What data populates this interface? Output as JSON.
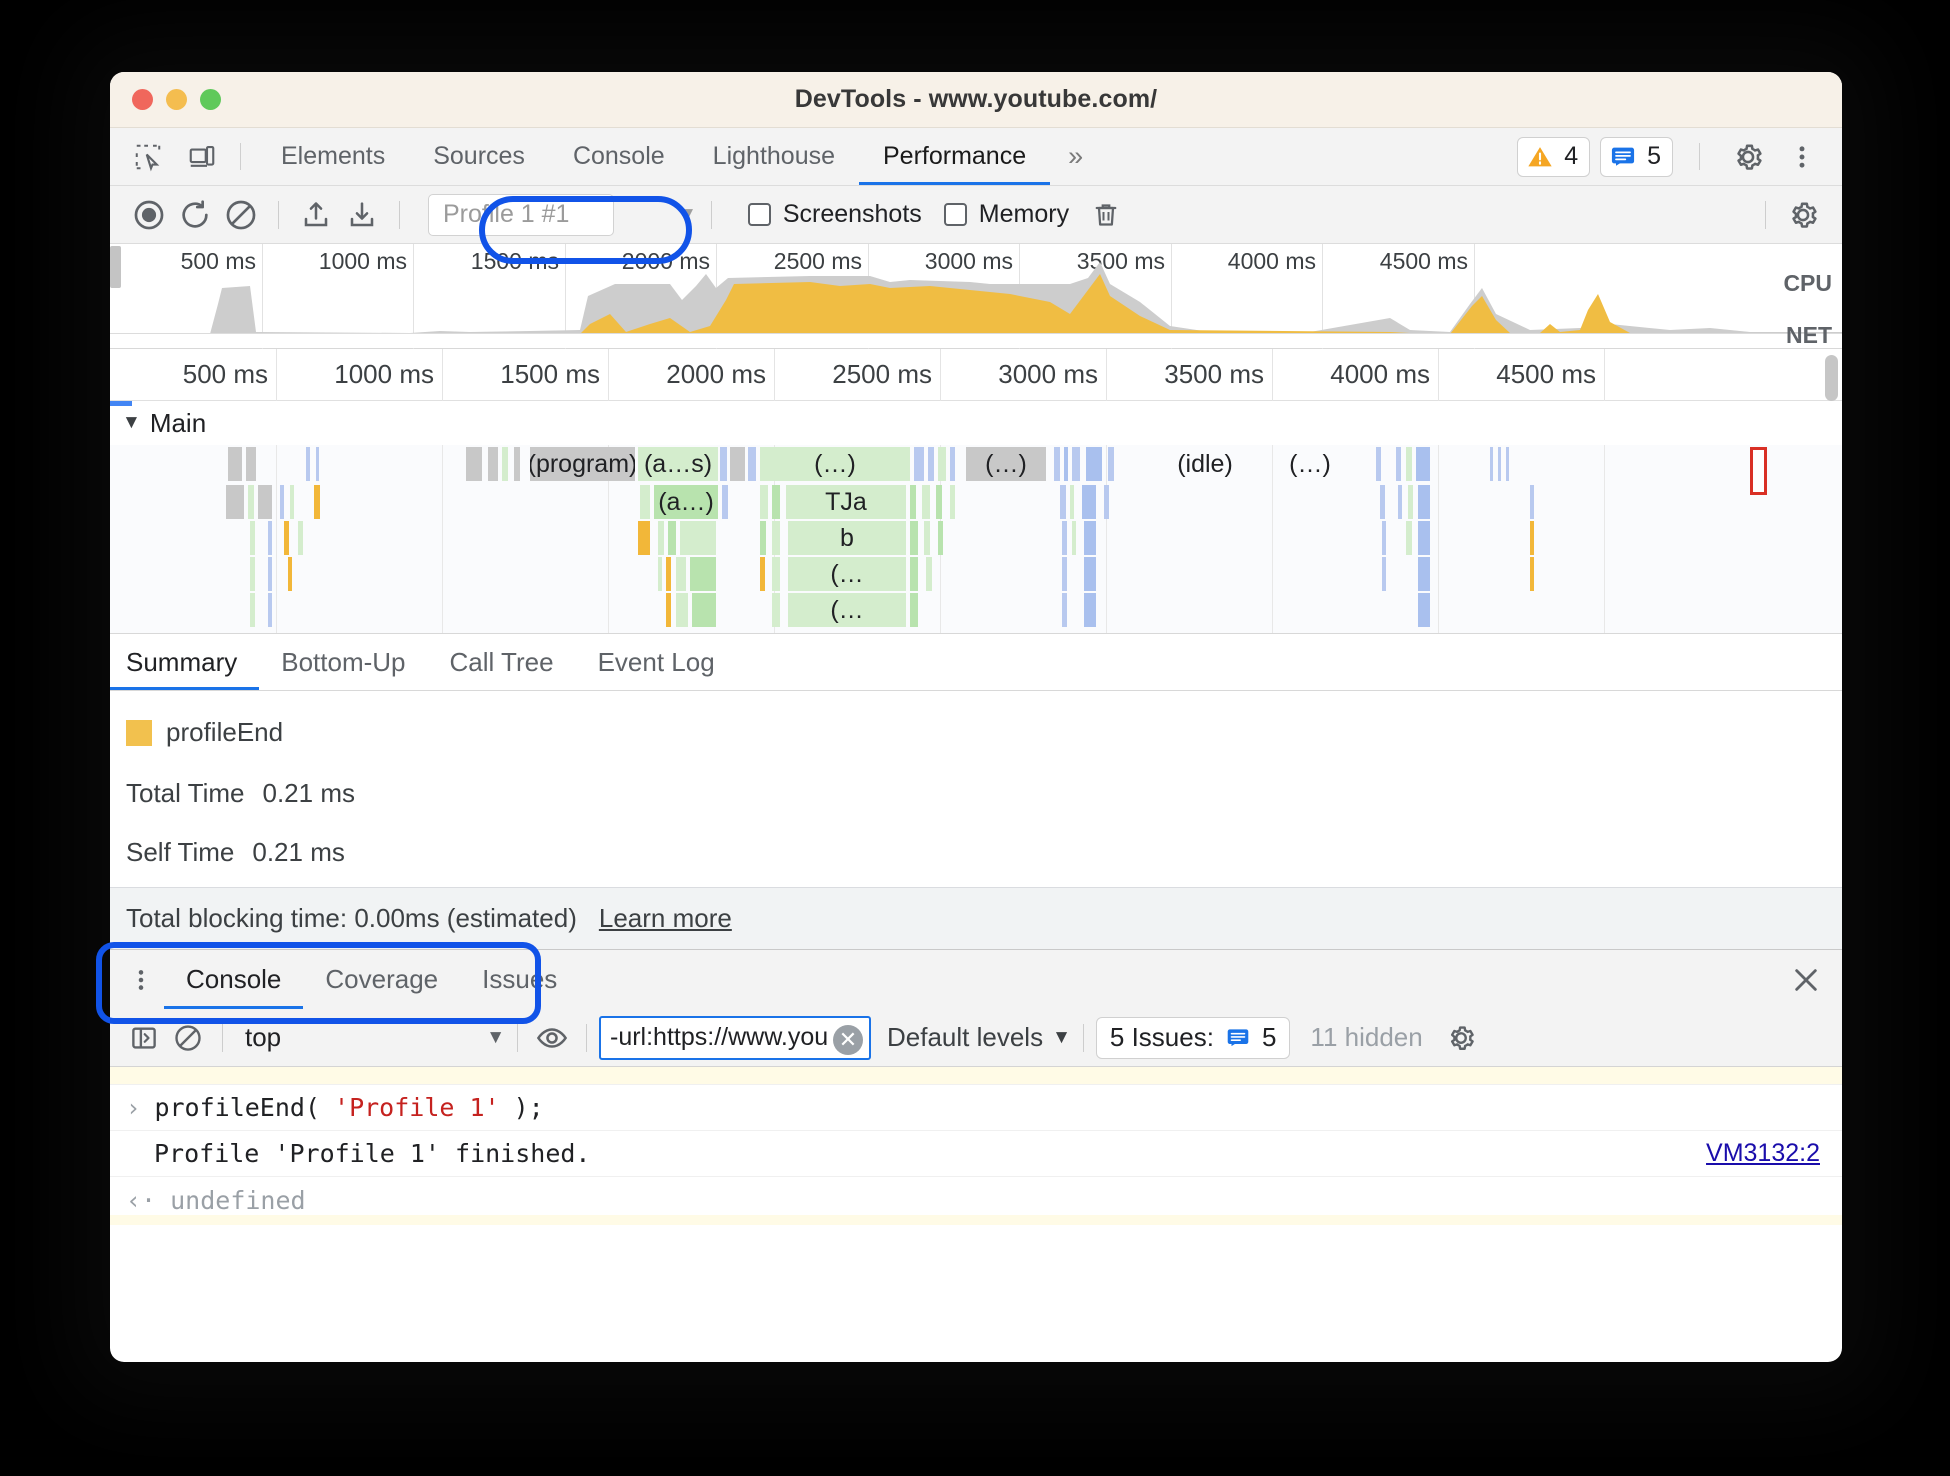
{
  "window": {
    "title": "DevTools - www.youtube.com/"
  },
  "main_tabs": {
    "items": [
      {
        "label": "Elements",
        "active": false
      },
      {
        "label": "Sources",
        "active": false
      },
      {
        "label": "Console",
        "active": false
      },
      {
        "label": "Lighthouse",
        "active": false
      },
      {
        "label": "Performance",
        "active": true
      }
    ],
    "more_label": "»",
    "warnings_count": "4",
    "issues_count": "5"
  },
  "perf_toolbar": {
    "profile_value": "Profile 1 #1",
    "caret": "▼",
    "screenshots_label": "Screenshots",
    "memory_label": "Memory",
    "screenshots_checked": false,
    "memory_checked": false
  },
  "overview": {
    "ticks": [
      "500 ms",
      "1000 ms",
      "1500 ms",
      "2000 ms",
      "2500 ms",
      "3000 ms",
      "3500 ms",
      "4000 ms",
      "4500 ms"
    ],
    "cpu_label": "CPU",
    "net_label": "NET"
  },
  "flame": {
    "ruler_ticks": [
      "500 ms",
      "1000 ms",
      "1500 ms",
      "2000 ms",
      "2500 ms",
      "3000 ms",
      "3500 ms",
      "4000 ms",
      "4500 ms"
    ],
    "track_label": "Main",
    "track_triangle": "▼",
    "bars": {
      "program": "(program)",
      "a_s": "(a…s)",
      "dots1": "(…)",
      "dots2": "(…)",
      "idle": "(idle)",
      "dots3": "(…)",
      "a_dots": "(a…)",
      "tja": "TJa",
      "b": "b",
      "dots4": "(…",
      "dots5": "(…"
    }
  },
  "summary": {
    "tabs": [
      {
        "label": "Summary",
        "active": true
      },
      {
        "label": "Bottom-Up",
        "active": false
      },
      {
        "label": "Call Tree",
        "active": false
      },
      {
        "label": "Event Log",
        "active": false
      }
    ],
    "legend_label": "profileEnd",
    "legend_color": "#f2c14e",
    "total_time_label": "Total Time",
    "total_time_value": "0.21 ms",
    "self_time_label": "Self Time",
    "self_time_value": "0.21 ms",
    "blocking_text": "Total blocking time: 0.00ms (estimated)",
    "learn_more": "Learn more"
  },
  "drawer": {
    "tabs": [
      {
        "label": "Console",
        "active": true
      },
      {
        "label": "Coverage",
        "active": false
      },
      {
        "label": "Issues",
        "active": false
      }
    ],
    "close_label": "✕"
  },
  "console_toolbar": {
    "context_value": "top",
    "context_caret": "▼",
    "filter_value": "-url:https://www.you",
    "levels_label": "Default levels",
    "levels_caret": "▼",
    "issues_label": "5 Issues:",
    "issues_count": "5",
    "hidden_label": "11 hidden"
  },
  "console_output": {
    "prompt_symbol": "›",
    "command_prefix": "profileEnd(",
    "command_string": "'Profile 1'",
    "command_suffix": ");",
    "result_text": "Profile 'Profile 1' finished.",
    "result_link": "VM3132:2",
    "undefined_symbol": "‹·",
    "undefined_text": "undefined"
  },
  "colors": {
    "accent": "#1a73e8",
    "highlight_ring": "#1153e8",
    "warning": "#f29900",
    "profile_swatch": "#f2c14e"
  }
}
